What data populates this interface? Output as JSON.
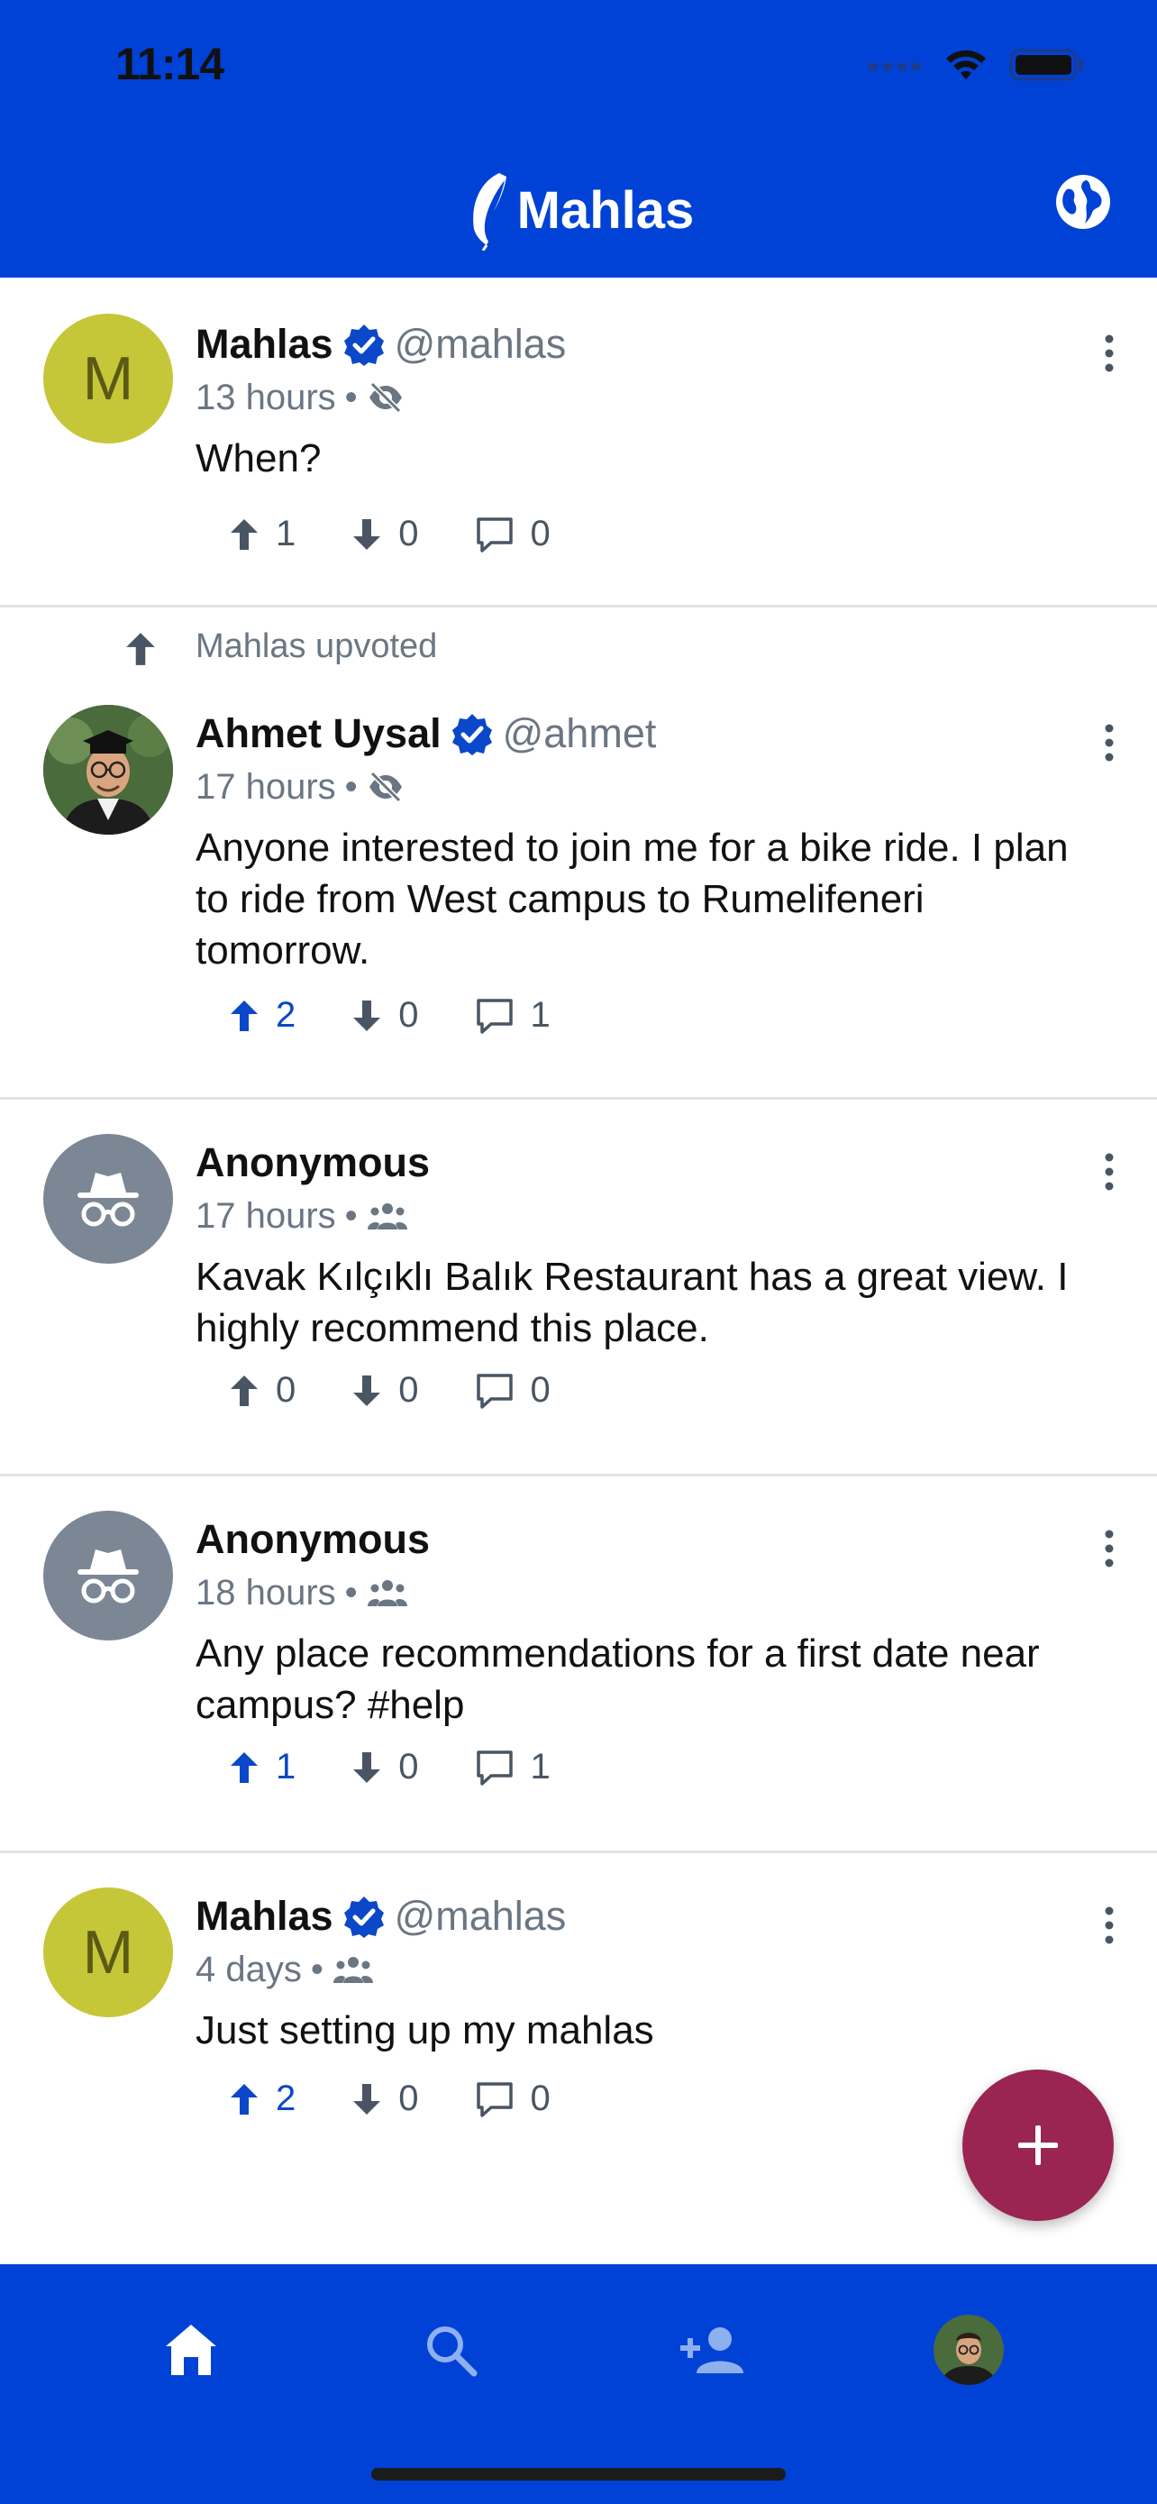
{
  "status_bar": {
    "time": "11:14"
  },
  "app": {
    "title": "Mahlas"
  },
  "posts": [
    {
      "avatar_letter": "M",
      "name": "Mahlas",
      "handle": "@mahlas",
      "time": "13 hours",
      "visibility_icon": "eye-off-icon",
      "text": "When?",
      "upvotes": "1",
      "downvotes": "0",
      "comments": "0"
    },
    {
      "upvoted_note": "Mahlas upvoted",
      "name": "Ahmet Uysal",
      "handle": "@ahmet",
      "time": "17 hours",
      "visibility_icon": "eye-off-icon",
      "text": "Anyone interested to join me for a bike ride. I plan to ride from West campus to Rumelifeneri tomorrow.",
      "upvotes": "2",
      "downvotes": "0",
      "comments": "1"
    },
    {
      "name": "Anonymous",
      "time": "17 hours",
      "visibility_icon": "group-icon",
      "text": "Kavak Kılçıklı Balık Restaurant has a great view. I highly recommend this place.",
      "upvotes": "0",
      "downvotes": "0",
      "comments": "0"
    },
    {
      "name": "Anonymous",
      "time": "18 hours",
      "visibility_icon": "group-icon",
      "text": "Any place recommendations for a first date near campus? #help",
      "upvotes": "1",
      "downvotes": "0",
      "comments": "1"
    },
    {
      "avatar_letter": "M",
      "name": "Mahlas",
      "handle": "@mahlas",
      "time": "4 days",
      "visibility_icon": "group-icon",
      "text": "Just setting up my mahlas",
      "upvotes": "2",
      "downvotes": "0",
      "comments": "0"
    }
  ],
  "colors": {
    "primary": "#0042d6",
    "fab": "#9a2452",
    "active_vote": "#0b47c9",
    "avatar_letter_bg": "#c6c639"
  }
}
